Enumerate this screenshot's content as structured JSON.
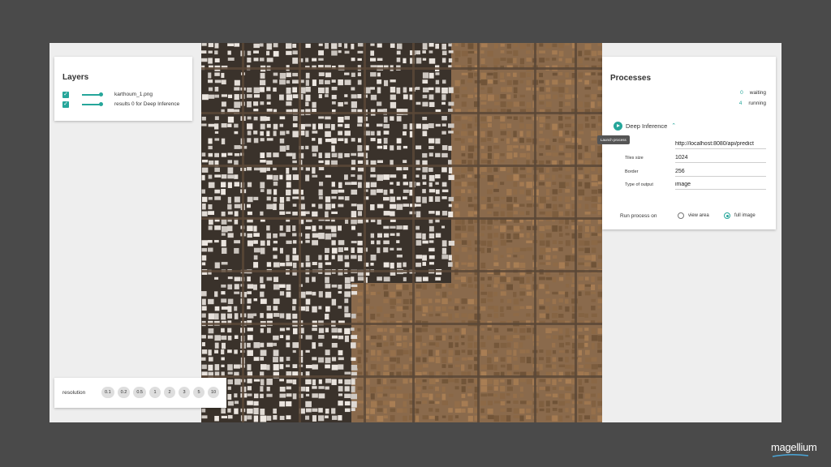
{
  "layers": {
    "title": "Layers",
    "items": [
      {
        "label": "karthoum_1.png",
        "checked": true
      },
      {
        "label": "results 0 for Deep Inference",
        "checked": true
      }
    ]
  },
  "resolution": {
    "label": "resolution",
    "options": [
      "0.1",
      "0.2",
      "0.5",
      "1",
      "2",
      "3",
      "5",
      "10"
    ]
  },
  "processes": {
    "title": "Processes",
    "waiting_count": "0",
    "waiting_label": "waiting",
    "running_count": "4",
    "running_label": "running",
    "process_name": "Deep Inference",
    "tooltip": "Launch process",
    "url_value": "http://localhost:8080/api/predict",
    "fields": [
      {
        "label": "Tiles size",
        "value": "1024"
      },
      {
        "label": "Border",
        "value": "256"
      },
      {
        "label": "Type of output",
        "value": "image"
      }
    ],
    "run_label": "Run process on",
    "run_options": [
      {
        "label": "view area",
        "selected": false
      },
      {
        "label": "full image",
        "selected": true
      }
    ]
  },
  "brand": {
    "logo_text": "magellium",
    "accent_color": "#26a69a"
  }
}
